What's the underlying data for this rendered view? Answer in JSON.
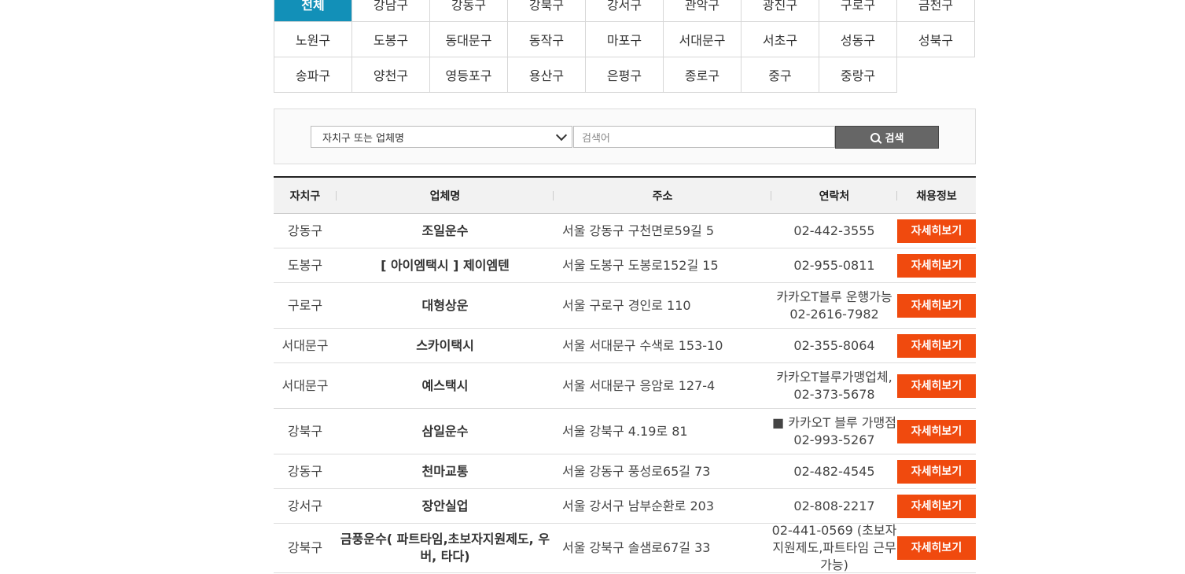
{
  "districts": [
    "전체",
    "강남구",
    "강동구",
    "강북구",
    "강서구",
    "관악구",
    "광진구",
    "구로구",
    "금천구",
    "노원구",
    "도봉구",
    "동대문구",
    "동작구",
    "마포구",
    "서대문구",
    "서초구",
    "성동구",
    "성북구",
    "송파구",
    "양천구",
    "영등포구",
    "용산구",
    "은평구",
    "종로구",
    "중구",
    "중랑구"
  ],
  "active_district": "전체",
  "search": {
    "select_value": "자치구 또는 업체명",
    "placeholder": "검색어",
    "button_label": "검색"
  },
  "table": {
    "headers": [
      "자치구",
      "업체명",
      "주소",
      "연락처",
      "채용정보"
    ],
    "detail_label": "자세히보기",
    "rows": [
      {
        "district": "강동구",
        "name": "조일운수",
        "address": "서울 강동구 구천면로59길 5",
        "contact": "02-442-3555"
      },
      {
        "district": "도봉구",
        "name": "[ 아이엠택시 ] 제이엠텐",
        "address": "서울 도봉구 도봉로152길 15",
        "contact": "02-955-0811"
      },
      {
        "district": "구로구",
        "name": "대형상운",
        "address": "서울 구로구 경인로 110",
        "contact": "카카오T블루 운행가능 02-2616-7982"
      },
      {
        "district": "서대문구",
        "name": "스카이택시",
        "address": "서울 서대문구 수색로 153-10",
        "contact": "02-355-8064"
      },
      {
        "district": "서대문구",
        "name": "예스택시",
        "address": "서울 서대문구 응암로 127-4",
        "contact": "카카오T블루가맹업체, 02-373-5678"
      },
      {
        "district": "강북구",
        "name": "삼일운수",
        "address": "서울 강북구 4.19로 81",
        "contact": "■ 카카오T 블루 가맹점 02-993-5267"
      },
      {
        "district": "강동구",
        "name": "천마교통",
        "address": "서울 강동구 풍성로65길 73",
        "contact": "02-482-4545"
      },
      {
        "district": "강서구",
        "name": "장안실업",
        "address": "서울 강서구 남부순환로 203",
        "contact": "02-808-2217"
      },
      {
        "district": "강북구",
        "name": "금풍운수( 파트타임,초보자지원제도, 우버, 타다)",
        "address": "서울 강북구 솔샘로67길 33",
        "contact": "02-441-0569 (초보자 지원제도,파트타임 근무 가능)"
      }
    ]
  }
}
